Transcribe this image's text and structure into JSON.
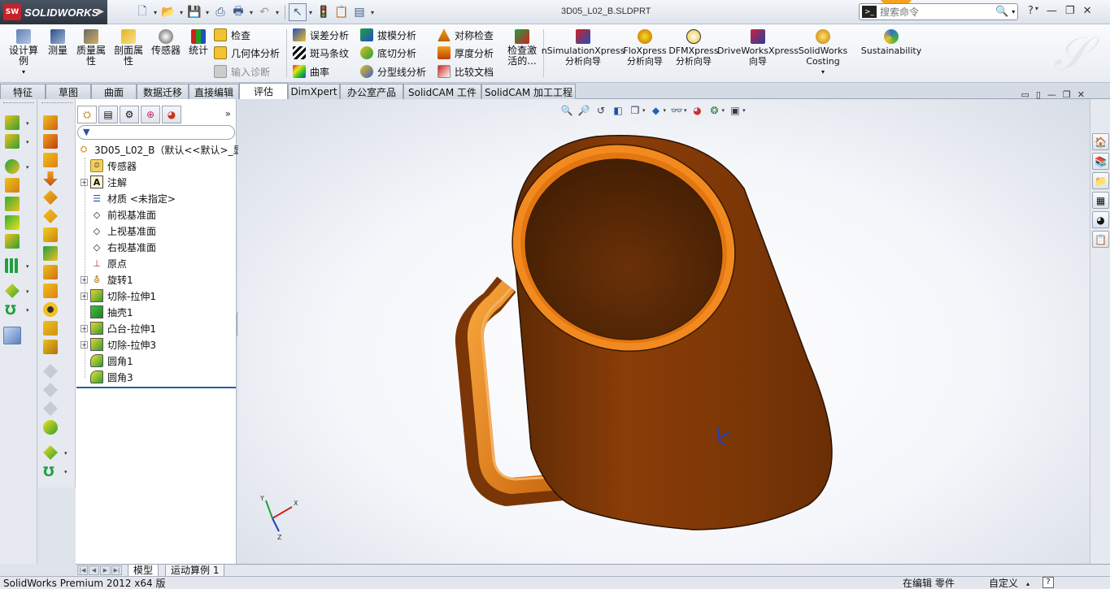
{
  "app": {
    "brand": "SOLIDWORKS",
    "brand_mark": "SW",
    "document_title": "3D05_L02_B.SLDPRT"
  },
  "search": {
    "placeholder": "搜索命令"
  },
  "command_manager": {
    "big_buttons": [
      {
        "id": "design-study",
        "label": "设计算例",
        "icon": "design-study-icon"
      },
      {
        "id": "measure",
        "label": "测量",
        "icon": "measure-icon"
      },
      {
        "id": "mass-props",
        "label": "质量属性",
        "icon": "scale-icon"
      },
      {
        "id": "section-props",
        "label": "剖面属性",
        "icon": "section-icon"
      },
      {
        "id": "sensor",
        "label": "传感器",
        "icon": "gauge-icon"
      },
      {
        "id": "stats",
        "label": "统计",
        "icon": "statistics-icon"
      },
      {
        "id": "check-active",
        "label": "检查激活的...",
        "icon": "check-doc-icon"
      },
      {
        "id": "simxpress",
        "label": "nSimulationXpress 分析向导",
        "icon": "simulation-icon"
      },
      {
        "id": "floxpress",
        "label": "FloXpress 分析向导",
        "icon": "floxpress-icon"
      },
      {
        "id": "dfmxpress",
        "label": "DFMXpress 分析向导",
        "icon": "dfm-icon"
      },
      {
        "id": "driveworks",
        "label": "DriveWorksXpress 向导",
        "icon": "driveworks-icon"
      },
      {
        "id": "costing",
        "label": "SolidWorks Costing",
        "icon": "coins-icon"
      },
      {
        "id": "sustain",
        "label": "Sustainability",
        "icon": "globe-icon"
      }
    ],
    "small_buttons": [
      {
        "id": "check",
        "label": "检查",
        "icon": "check-icon",
        "disabled": false
      },
      {
        "id": "geom-analysis",
        "label": "几何体分析",
        "icon": "check-icon",
        "disabled": false
      },
      {
        "id": "import-diag",
        "label": "输入诊断",
        "icon": "import-diag-icon",
        "disabled": true
      },
      {
        "id": "deviation",
        "label": "误差分析",
        "icon": "deviation-icon",
        "disabled": false
      },
      {
        "id": "zebra",
        "label": "斑马条纹",
        "icon": "zebra-icon",
        "disabled": false
      },
      {
        "id": "curvature",
        "label": "曲率",
        "icon": "curvature-icon",
        "disabled": false
      },
      {
        "id": "draft",
        "label": "拔模分析",
        "icon": "draft-icon",
        "disabled": false
      },
      {
        "id": "undercut",
        "label": "底切分析",
        "icon": "undercut-icon",
        "disabled": false
      },
      {
        "id": "parting",
        "label": "分型线分析",
        "icon": "parting-icon",
        "disabled": false
      },
      {
        "id": "symmetry",
        "label": "对称检查",
        "icon": "symmetry-icon",
        "disabled": false
      },
      {
        "id": "thickness",
        "label": "厚度分析",
        "icon": "thickness-icon",
        "disabled": false
      },
      {
        "id": "compare",
        "label": "比较文档",
        "icon": "compare-icon",
        "disabled": false
      }
    ]
  },
  "tabs": [
    {
      "label": "特征",
      "active": false
    },
    {
      "label": "草图",
      "active": false
    },
    {
      "label": "曲面",
      "active": false
    },
    {
      "label": "数据迁移",
      "active": false
    },
    {
      "label": "直接编辑",
      "active": false
    },
    {
      "label": "评估",
      "active": true
    },
    {
      "label": "DimXpert",
      "active": false
    },
    {
      "label": "办公室产品",
      "active": false
    },
    {
      "label": "SolidCAM 工件",
      "active": false
    },
    {
      "label": "SolidCAM 加工工程",
      "active": false
    }
  ],
  "feature_tree": {
    "root": "3D05_L02_B（默认<<默认>_显",
    "more": "»",
    "items": [
      {
        "label": "传感器",
        "icon": "sensor-icon",
        "expandable": false
      },
      {
        "label": "注解",
        "icon": "annotation-icon",
        "expandable": true
      },
      {
        "label": "材质 <未指定>",
        "icon": "material-icon",
        "expandable": false
      },
      {
        "label": "前视基准面",
        "icon": "plane-icon",
        "expandable": false
      },
      {
        "label": "上视基准面",
        "icon": "plane-icon",
        "expandable": false
      },
      {
        "label": "右视基准面",
        "icon": "plane-icon",
        "expandable": false
      },
      {
        "label": "原点",
        "icon": "origin-icon",
        "expandable": false
      },
      {
        "label": "旋转1",
        "icon": "revolve-icon",
        "expandable": true
      },
      {
        "label": "切除-拉伸1",
        "icon": "cut-extrude-icon",
        "expandable": true
      },
      {
        "label": "抽壳1",
        "icon": "shell-icon",
        "expandable": false
      },
      {
        "label": "凸台-拉伸1",
        "icon": "boss-extrude-icon",
        "expandable": true
      },
      {
        "label": "切除-拉伸3",
        "icon": "cut-extrude-icon",
        "expandable": true
      },
      {
        "label": "圆角1",
        "icon": "fillet-icon",
        "expandable": false
      },
      {
        "label": "圆角3",
        "icon": "fillet-icon",
        "expandable": false
      }
    ]
  },
  "model_tabs": [
    {
      "label": "模型",
      "active": true
    },
    {
      "label": "运动算例 1",
      "active": false
    }
  ],
  "status": {
    "product": "SolidWorks Premium 2012 x64 版",
    "editing": "在编辑 零件",
    "units": "自定义"
  },
  "colors": {
    "mug_body": "#8a3d08",
    "mug_rim": "#f28a1f",
    "accent_blue": "#2a5ea8"
  }
}
